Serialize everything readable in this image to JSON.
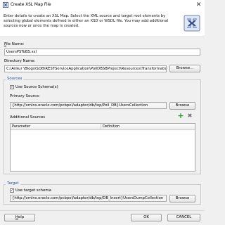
{
  "window": {
    "title": "Create XSL Map File",
    "close_glyph": "✕"
  },
  "header": {
    "intro": "Enter details to create an XSL Map. Select the XML source and target root elements by selecting global elements defined in either an XSD or WSDL file.  You may add additional sources now or once the map is created."
  },
  "file_name": {
    "label": "File Name:",
    "value": "UsersPSToBS.xsl"
  },
  "directory_name": {
    "label": "Directory Name:",
    "value": "C:\\Ankur \\Blogs\\SOB\\RESTServiceApplication\\PollDBSBProject\\Resources\\Transformations",
    "browse": "Browse..."
  },
  "sources": {
    "legend": "Sources",
    "use_schema_label": "Use Source Schema(s)",
    "use_schema_checked": true,
    "primary_label": "Primary Source:",
    "primary_value": "{http://xmlns.oracle.com/pcbpel/adapter/db/top/Poll_DB}UsersCollection",
    "browse": "Browse",
    "additional_label": "Additional Sources",
    "columns": [
      "Parameter",
      "Definition"
    ],
    "add_glyph": "+",
    "remove_glyph": "✖"
  },
  "target": {
    "legend": "Target",
    "use_schema_label": "Use target schema",
    "use_schema_checked": true,
    "value": "{http://xmlns.oracle.com/pcbpel/adapter/db/top/DB_Insert}UsersDumpCollection",
    "browse": "Browse"
  },
  "footer": {
    "help": "Help",
    "ok": "OK",
    "cancel": "CANCEL"
  },
  "colors": {
    "accent": "#2050a0",
    "add": "#2a9a2a",
    "remove": "#707070"
  }
}
